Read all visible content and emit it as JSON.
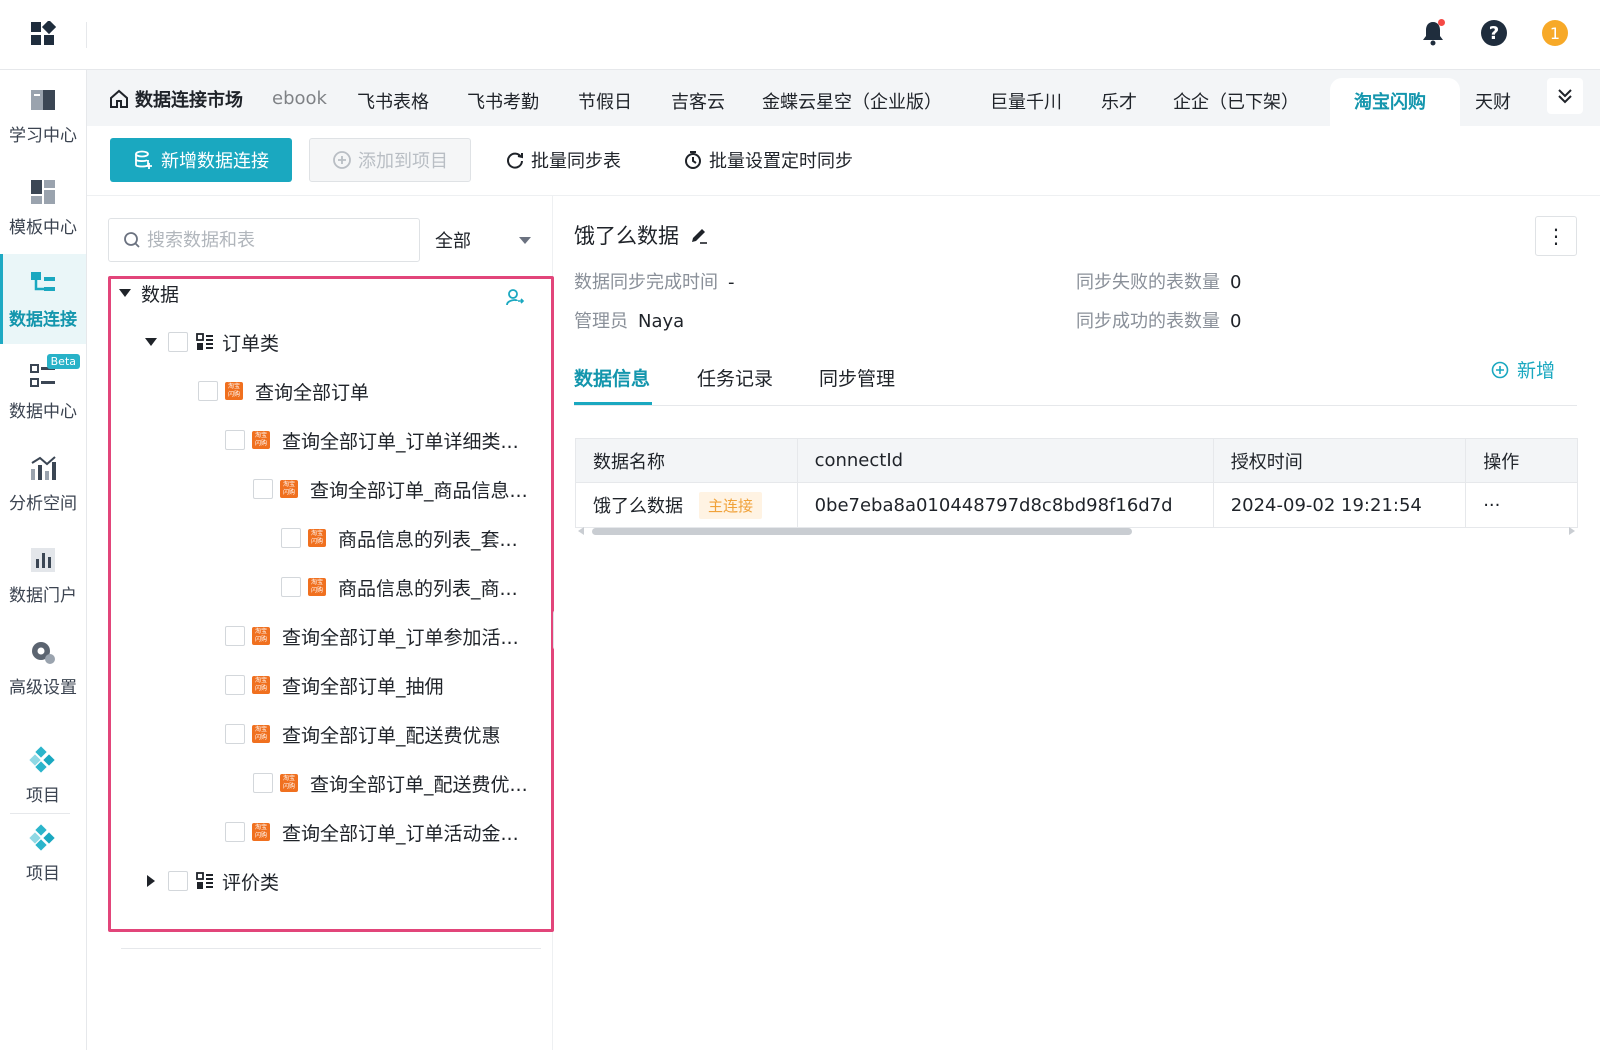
{
  "topbar": {
    "icons": [
      "app-grid-icon",
      "bell-icon",
      "help-icon",
      "user-avatar-icon"
    ],
    "help_symbol": "?",
    "user_initial": "1",
    "notification_dot_color": "#f54a45"
  },
  "sidebar": {
    "items": [
      {
        "label": "学习中心",
        "icon": "book-icon"
      },
      {
        "label": "模板中心",
        "icon": "template-icon"
      },
      {
        "label": "数据连接",
        "icon": "data-connection-icon",
        "active": true
      },
      {
        "label": "数据中心",
        "icon": "data-center-icon",
        "badge": "Beta"
      },
      {
        "label": "分析空间",
        "icon": "analysis-icon"
      },
      {
        "label": "数据门户",
        "icon": "portal-icon"
      },
      {
        "label": "高级设置",
        "icon": "gear-icon"
      },
      {
        "label": "项目",
        "icon": "project-icon"
      },
      {
        "label": "项目",
        "icon": "project-icon"
      }
    ]
  },
  "tabbar": {
    "title": "数据连接市场",
    "tabs": [
      "ebook",
      "飞书表格",
      "飞书考勤",
      "节假日",
      "吉客云",
      "金蝶云星空（企业版）",
      "巨量千川",
      "乐才",
      "企企（已下架）",
      "淘宝闪购",
      "天财"
    ],
    "active_tab": "淘宝闪购"
  },
  "toolbar": {
    "new_connection": "新增数据连接",
    "add_to_project": "添加到项目",
    "batch_sync": "批量同步表",
    "batch_schedule": "批量设置定时同步"
  },
  "left_panel": {
    "search_placeholder": "搜索数据和表",
    "filter_value": "全部",
    "tree": {
      "root": "数据",
      "group_order": "订单类",
      "items": [
        "查询全部订单",
        "查询全部订单_订单详细类...",
        "查询全部订单_商品信息...",
        "商品信息的列表_套...",
        "商品信息的列表_商...",
        "查询全部订单_订单参加活...",
        "查询全部订单_抽佣",
        "查询全部订单_配送费优惠",
        "查询全部订单_配送费优...",
        "查询全部订单_订单活动金..."
      ],
      "group_review": "评价类"
    },
    "source_icon_text": [
      "淘宝",
      "闪购"
    ],
    "highlight_color": "#e2457a"
  },
  "detail": {
    "title": "饿了么数据",
    "sync_time_label": "数据同步完成时间",
    "sync_time_value": "-",
    "admin_label": "管理员",
    "admin_value": "Naya",
    "failed_label": "同步失败的表数量",
    "failed_value": "0",
    "success_label": "同步成功的表数量",
    "success_value": "0",
    "tabs": [
      "数据信息",
      "任务记录",
      "同步管理"
    ],
    "add_label": "新增",
    "more_symbol": "⋮",
    "table": {
      "headers": [
        "数据名称",
        "connectId",
        "授权时间",
        "操作"
      ],
      "rows": [
        {
          "name": "饿了么数据",
          "tag": "主连接",
          "connect_id": "0be7eba8a010448797d8c8bd98f16d7d",
          "auth_time": "2024-09-02 19:21:54",
          "action": "···"
        }
      ]
    }
  },
  "colors": {
    "accent": "#1aa8c0",
    "accent_text": "#1496ad",
    "tag_bg": "#fff3e3",
    "tag_text": "#f0a23a",
    "source_icon": "#f0701f"
  }
}
